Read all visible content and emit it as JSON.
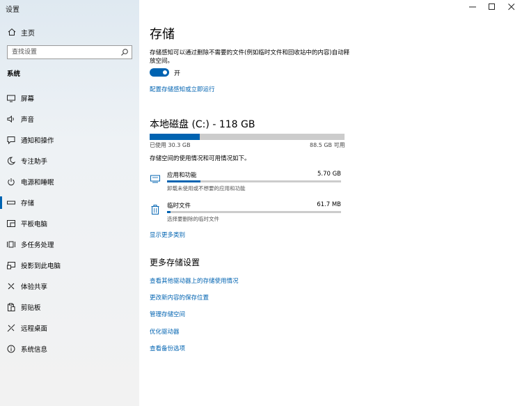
{
  "app": {
    "title": "设置"
  },
  "window": {
    "minimize": "—",
    "maximize": "☐",
    "close": "✕"
  },
  "sidebar": {
    "home_label": "主页",
    "search_placeholder": "查找设置",
    "section": "系统",
    "items": [
      {
        "label": "屏幕",
        "icon": "display-icon"
      },
      {
        "label": "声音",
        "icon": "speaker-icon"
      },
      {
        "label": "通知和操作",
        "icon": "notification-icon"
      },
      {
        "label": "专注助手",
        "icon": "moon-icon"
      },
      {
        "label": "电源和睡眠",
        "icon": "power-icon"
      },
      {
        "label": "存储",
        "icon": "storage-icon",
        "selected": true
      },
      {
        "label": "平板电脑",
        "icon": "tablet-icon"
      },
      {
        "label": "多任务处理",
        "icon": "multitask-icon"
      },
      {
        "label": "投影到此电脑",
        "icon": "project-icon"
      },
      {
        "label": "体验共享",
        "icon": "share-icon"
      },
      {
        "label": "剪贴板",
        "icon": "clipboard-icon"
      },
      {
        "label": "远程桌面",
        "icon": "remote-desktop-icon"
      },
      {
        "label": "系统信息",
        "icon": "info-icon"
      }
    ]
  },
  "main": {
    "title": "存储",
    "storage_sense_desc": "存储感知可以通过删除不需要的文件(例如临时文件和回收站中的内容)自动释放空间。",
    "toggle_state": "开",
    "toggle_on": true,
    "configure_link": "配置存储感知或立即运行",
    "disk": {
      "title": "本地磁盘 (C:) - 118 GB",
      "used": "已使用 30.3 GB",
      "free": "88.5 GB 可用",
      "used_fraction": 0.257,
      "desc": "存储空间的使用情况和可用情况如下。"
    },
    "categories": [
      {
        "name": "应用和功能",
        "size": "5.70 GB",
        "sub": "卸载未使用或不想要的应用和功能",
        "fraction": 0.19,
        "icon": "apps-icon"
      },
      {
        "name": "临时文件",
        "size": "61.7 MB",
        "sub": "选择要删除的临时文件",
        "fraction": 0.02,
        "icon": "trash-icon"
      }
    ],
    "show_more": "显示更多类别",
    "more_title": "更多存储设置",
    "more_links": [
      "查看其他驱动器上的存储使用情况",
      "更改新内容的保存位置",
      "管理存储空间",
      "优化驱动器",
      "查看备份选项"
    ]
  }
}
